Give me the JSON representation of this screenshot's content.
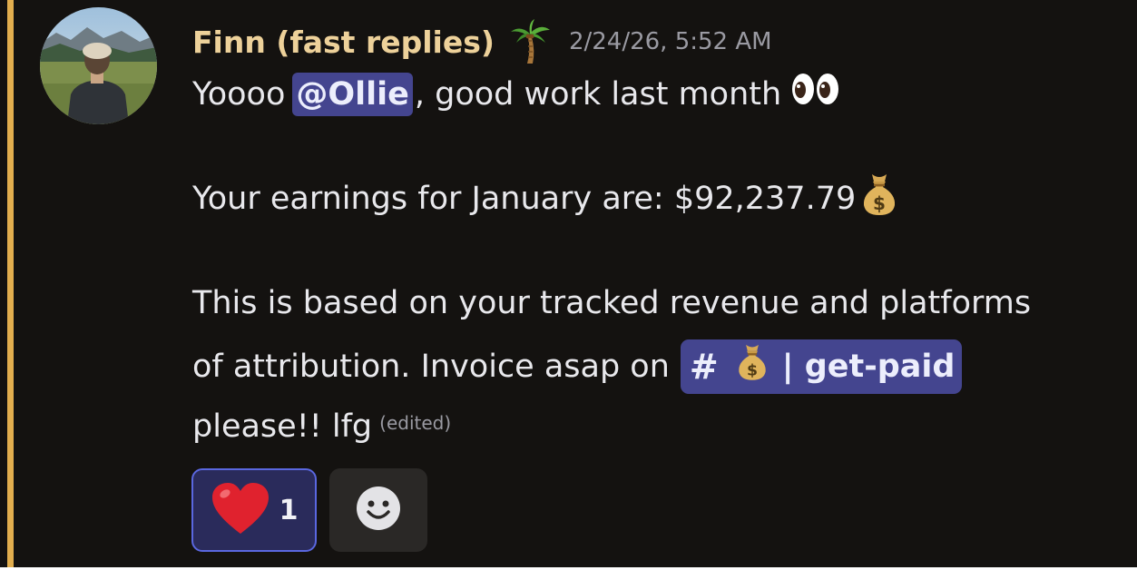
{
  "message": {
    "author": "Finn (fast replies)",
    "author_badge_icon": "palm-tree-icon",
    "timestamp": "2/24/26, 5:52 AM",
    "line1": {
      "prefix": "Yoooo",
      "mention": "@Ollie",
      "suffix": ", good work last month",
      "trailing_icon": "eyes-icon"
    },
    "line2": {
      "text": "Your earnings for January are: $92,237.79",
      "trailing_icon": "money-bag-icon"
    },
    "line3": {
      "text": "This is based on your tracked revenue and platforms"
    },
    "line4": {
      "text": "of attribution. Invoice asap on",
      "channel": {
        "hash": "#",
        "icon": "money-bag-icon",
        "name": "| get-paid"
      }
    },
    "line5": {
      "text": "please!! lfg",
      "edited": "(edited)"
    }
  },
  "reactions": [
    {
      "icon": "red-heart-icon",
      "count": "1",
      "active": true
    }
  ],
  "add_reaction_icon": "smiley-face-icon",
  "colors": {
    "background": "#141210",
    "highlight_bar": "#e2ae4e",
    "author": "#edd19a",
    "mention_bg": "#44458f",
    "reaction_border": "#5a67df"
  }
}
